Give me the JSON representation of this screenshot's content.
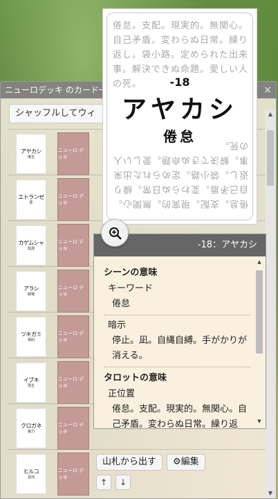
{
  "window": {
    "title": "ニューロデッキ のカード一",
    "close": "×",
    "shuffle_label": "シャッフルしてウィ"
  },
  "rows": [
    {
      "front_name": "アヤカシ",
      "front_sub": "倦怠",
      "back_text": "ニューロ デッキ"
    },
    {
      "front_name": "エトランゼ",
      "front_sub": "夢",
      "back_text": "ニューロ デッキ"
    },
    {
      "front_name": "カゲムシャ",
      "front_sub": "陰謀",
      "back_text": "ニューロ デッキ"
    },
    {
      "front_name": "アラシ",
      "front_sub": "破壊",
      "back_text": "ニューロ デッキ"
    },
    {
      "front_name": "ツキガミ",
      "front_sub": "契約",
      "back_text": "ニューロ デッキ"
    },
    {
      "front_name": "イブキ",
      "front_sub": "再生",
      "back_text": "ニューロ デッキ"
    },
    {
      "front_name": "クロガネ",
      "front_sub": "暴力",
      "back_text": "ニューロ デッキ"
    },
    {
      "front_name": "ヒルコ",
      "front_sub": "混沌",
      "back_text": "ニューロ デッキ"
    }
  ],
  "actions": {
    "draw_label": "山札から出す",
    "edit_label": "編集",
    "up_label": "↑",
    "down_label": "↓"
  },
  "card": {
    "number": "-18",
    "name": "アヤカシ",
    "keyword": "倦怠",
    "ghost_text": "倦怠。支配。現実的。無関心。自己矛盾。変わらぬ日常。繰り返し。袋小路。定められた出来事。解決できぬ命題。愛しい人の死。"
  },
  "info": {
    "header": "-18：アヤカシ",
    "scene_title": "シーンの意味",
    "keyword_label": "キーワード",
    "keyword_value": "倦怠",
    "hint_label": "暗示",
    "hint_value": "停止。凪。自縄自縛。手がかりが消える。",
    "tarot_title": "タロットの意味",
    "upright_label": "正位置",
    "upright_value": "倦怠。支配。現実的。無関心。自己矛盾。変わらぬ日常。繰り返"
  },
  "colors": {
    "card_back": "#c49a96",
    "header_bg": "#666666",
    "panel_bg": "#faf0e0"
  }
}
